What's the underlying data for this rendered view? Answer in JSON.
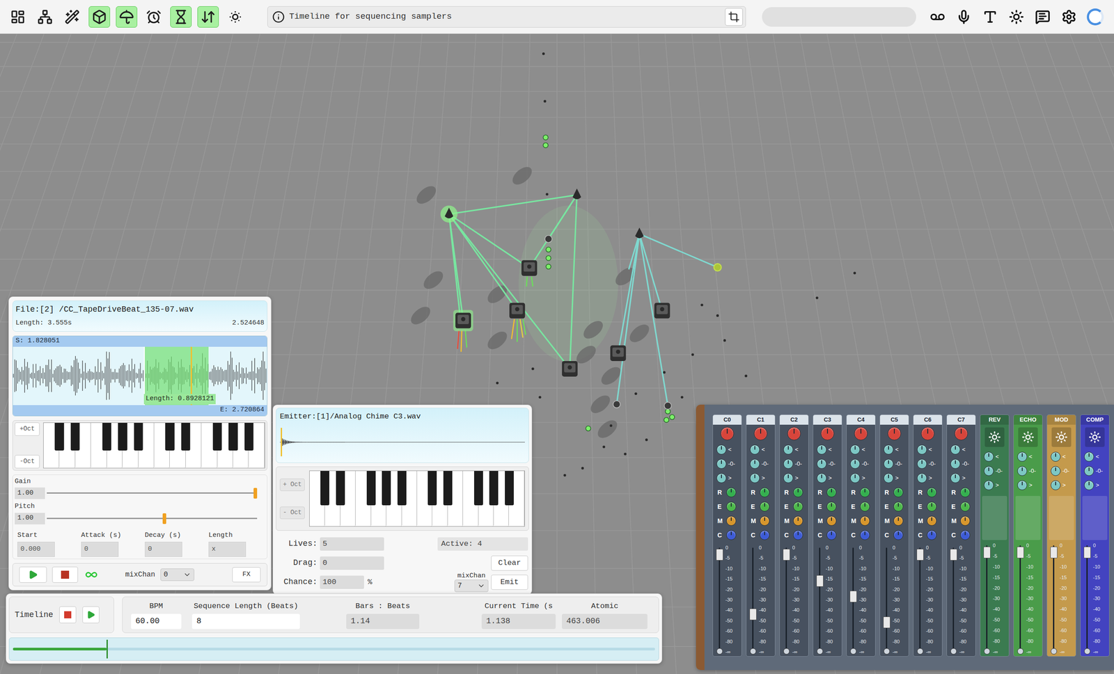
{
  "toolbar": {
    "left_tools": [
      {
        "selected": false
      },
      {
        "selected": false
      },
      {
        "selected": false
      },
      {
        "selected": true
      },
      {
        "selected": true
      },
      {
        "selected": false
      },
      {
        "selected": true
      },
      {
        "selected": true
      },
      {
        "selected": false
      }
    ],
    "info": "Timeline for sequencing samplers",
    "search": "",
    "right_tools": [
      {
        "selected": false
      },
      {
        "selected": false
      },
      {
        "selected": false
      },
      {
        "selected": false
      },
      {
        "selected": false
      },
      {
        "selected": false
      },
      {
        "selected": false
      }
    ]
  },
  "sampler": {
    "file": "File:[2] /CC_TapeDriveBeat_135-07.wav",
    "length": "Length: 3.555s",
    "end_time": "2.524648",
    "start_label": "S: 1.828051",
    "selection_label": "Length: 0.8928121",
    "end_label": "E: 2.720864",
    "selection_start": 0.516,
    "selection_end": 0.77,
    "playhead": 0.7,
    "octave_up": "+Oct",
    "octave_down": "-Oct",
    "sliders": [
      {
        "label": "Gain",
        "value": "1.00",
        "level": 1.0
      },
      {
        "label": "Pitch",
        "value": "1.00",
        "level": 0.56
      }
    ],
    "fields": [
      {
        "label": "Start",
        "value": "0.000"
      },
      {
        "label": "Attack (s)",
        "value": "0"
      },
      {
        "label": "Decay (s)",
        "value": "0"
      },
      {
        "label": "Length",
        "value": "x"
      }
    ],
    "loop": true,
    "mix_label": "mixChan",
    "mix_value": "0",
    "fx": "FX"
  },
  "emitter": {
    "file": "Emitter:[1]/Analog Chime C3.wav",
    "octave_up": "+ Oct",
    "octave_down": "- Oct",
    "lives_label": "Lives:",
    "lives": "5",
    "drag_label": "Drag:",
    "drag": "0",
    "chance_label": "Chance:",
    "chance": "100",
    "chance_unit": "%",
    "active": "Active: 4",
    "clear": "Clear",
    "mix_label": "mixChan",
    "mix_value": "7",
    "emit": "Emit"
  },
  "timeline": {
    "title": "Timeline",
    "fields": [
      {
        "label": "BPM",
        "value": "60.00",
        "editable": true
      },
      {
        "label": "Sequence Length (Beats)",
        "value": "8",
        "editable": true
      },
      {
        "label": "Bars : Beats",
        "value": "1.14",
        "editable": false
      },
      {
        "label": "Current Time (s",
        "value": "1.138",
        "editable": false
      },
      {
        "label": "Atomic",
        "value": "463.006",
        "editable": false
      }
    ],
    "progress": 0.146
  },
  "mixer": {
    "knob_marks": [
      "<",
      "-0-",
      ">"
    ],
    "sends": [
      {
        "label": "R",
        "color": "#35b04f"
      },
      {
        "label": "E",
        "color": "#4cb84a"
      },
      {
        "label": "M",
        "color": "#d7962c"
      },
      {
        "label": "C",
        "color": "#3d5bd6"
      }
    ],
    "scale": [
      "0",
      "-5",
      "-10",
      "-15",
      "-20",
      "-30",
      "-40",
      "-50",
      "-60",
      "-80",
      "-∞"
    ],
    "channels": [
      {
        "name": "C0",
        "level": 0.96
      },
      {
        "name": "C1",
        "level": 0.35
      },
      {
        "name": "C2",
        "level": 0.96
      },
      {
        "name": "C3",
        "level": 0.69
      },
      {
        "name": "C4",
        "level": 0.53
      },
      {
        "name": "C5",
        "level": 0.27
      },
      {
        "name": "C6",
        "level": 0.96
      },
      {
        "name": "C7",
        "level": 0.96
      }
    ],
    "effects": [
      {
        "name": "REV",
        "color": "#3b7b50",
        "level": 0.96
      },
      {
        "name": "ECHO",
        "color": "#4a9c4a",
        "level": 0.96
      },
      {
        "name": "MOD",
        "color": "#c49a4c",
        "level": 0.96
      },
      {
        "name": "COMP",
        "color": "#4343c0",
        "level": 0.96
      }
    ]
  }
}
